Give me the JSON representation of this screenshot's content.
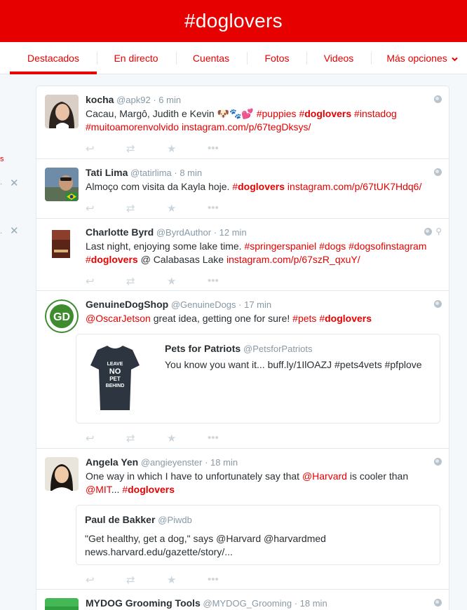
{
  "header": {
    "title": "#doglovers"
  },
  "tabs": [
    {
      "label": "Destacados",
      "active": true
    },
    {
      "label": "En directo"
    },
    {
      "label": "Cuentas"
    },
    {
      "label": "Fotos"
    },
    {
      "label": "Videos"
    },
    {
      "label": "Más opciones",
      "dropdown": true
    }
  ],
  "left_fragments": {
    "s": "s",
    "dot1": ".",
    "dot2": "."
  },
  "icons": {
    "reply": "reply-icon",
    "retweet": "retweet-icon",
    "favorite": "star-icon",
    "more": "more-icon",
    "globe": "globe-icon",
    "location": "location-pin-icon",
    "close": "close-icon"
  },
  "colors": {
    "brand": "#e60000",
    "muted": "#8899a6"
  },
  "tweets": [
    {
      "name": "kocha",
      "handle": "@apk92",
      "time": "6 min",
      "segments": [
        {
          "t": "Cacau, Margô, Judith e Kevin 🐶🐾💕 "
        },
        {
          "t": "#puppies ",
          "c": "red"
        },
        {
          "t": "#",
          "c": "red"
        },
        {
          "t": "doglovers",
          "c": "redb"
        },
        {
          "t": " ",
          "c": "red"
        },
        {
          "t": "#instadog ",
          "c": "red"
        },
        {
          "t": "#muitoamorenvolvido ",
          "c": "red"
        },
        {
          "t": "instagram.com/p/67tegDksys/",
          "c": "red"
        }
      ]
    },
    {
      "name": "Tati Lima",
      "handle": "@tatirlima",
      "time": "8 min",
      "segments": [
        {
          "t": "Almoço com visita da Kayla hoje. "
        },
        {
          "t": "#",
          "c": "red"
        },
        {
          "t": "doglovers",
          "c": "redb"
        },
        {
          "t": " instagram.com/p/67tUK7Hdq6/",
          "c": "red"
        }
      ]
    },
    {
      "name": "Charlotte Byrd",
      "handle": "@ByrdAuthor",
      "time": "12 min",
      "segments": [
        {
          "t": "Last night, enjoying some lake time. "
        },
        {
          "t": "#springerspaniel ",
          "c": "red"
        },
        {
          "t": "#dogs ",
          "c": "red"
        },
        {
          "t": "#dogsofinstagram ",
          "c": "red"
        },
        {
          "t": "#",
          "c": "red"
        },
        {
          "t": "doglovers",
          "c": "redb"
        },
        {
          "t": " @ Calabasas Lake "
        },
        {
          "t": "instagram.com/p/67szR_qxuY/",
          "c": "red"
        }
      ]
    },
    {
      "name": "GenuineDogShop",
      "handle": "@GenuineDogs",
      "time": "17 min",
      "segments": [
        {
          "t": "@OscarJetson",
          "c": "red"
        },
        {
          "t": " great idea, getting one for sure! "
        },
        {
          "t": "#pets ",
          "c": "red"
        },
        {
          "t": "#",
          "c": "red"
        },
        {
          "t": "doglovers",
          "c": "redb"
        }
      ],
      "card": {
        "name": "Pets for Patriots",
        "handle": "@PetsforPatriots",
        "text": "You know you want it... buff.ly/1IlOAZJ #pets4vets #pfplove",
        "shirt_text": [
          "LEAVE",
          "NO",
          "PET",
          "BEHIND"
        ]
      }
    },
    {
      "name": "Angela Yen",
      "handle": "@angieyenster",
      "time": "18 min",
      "segments": [
        {
          "t": "One way in which I have to unfortunately say that "
        },
        {
          "t": "@Harvard",
          "c": "red"
        },
        {
          "t": " is cooler than "
        },
        {
          "t": "@MIT",
          "c": "red"
        },
        {
          "t": "... "
        },
        {
          "t": "#",
          "c": "red"
        },
        {
          "t": "doglovers",
          "c": "redb"
        }
      ],
      "quote": {
        "name": "Paul de Bakker",
        "handle": "@Piwdb",
        "text": "\"Get healthy, get a dog,\" says @Harvard @harvardmed news.harvard.edu/gazette/story/..."
      }
    },
    {
      "name": "MYDOG Grooming Tools",
      "handle": "@MYDOG_Grooming",
      "time": "18 min",
      "segments": []
    }
  ]
}
